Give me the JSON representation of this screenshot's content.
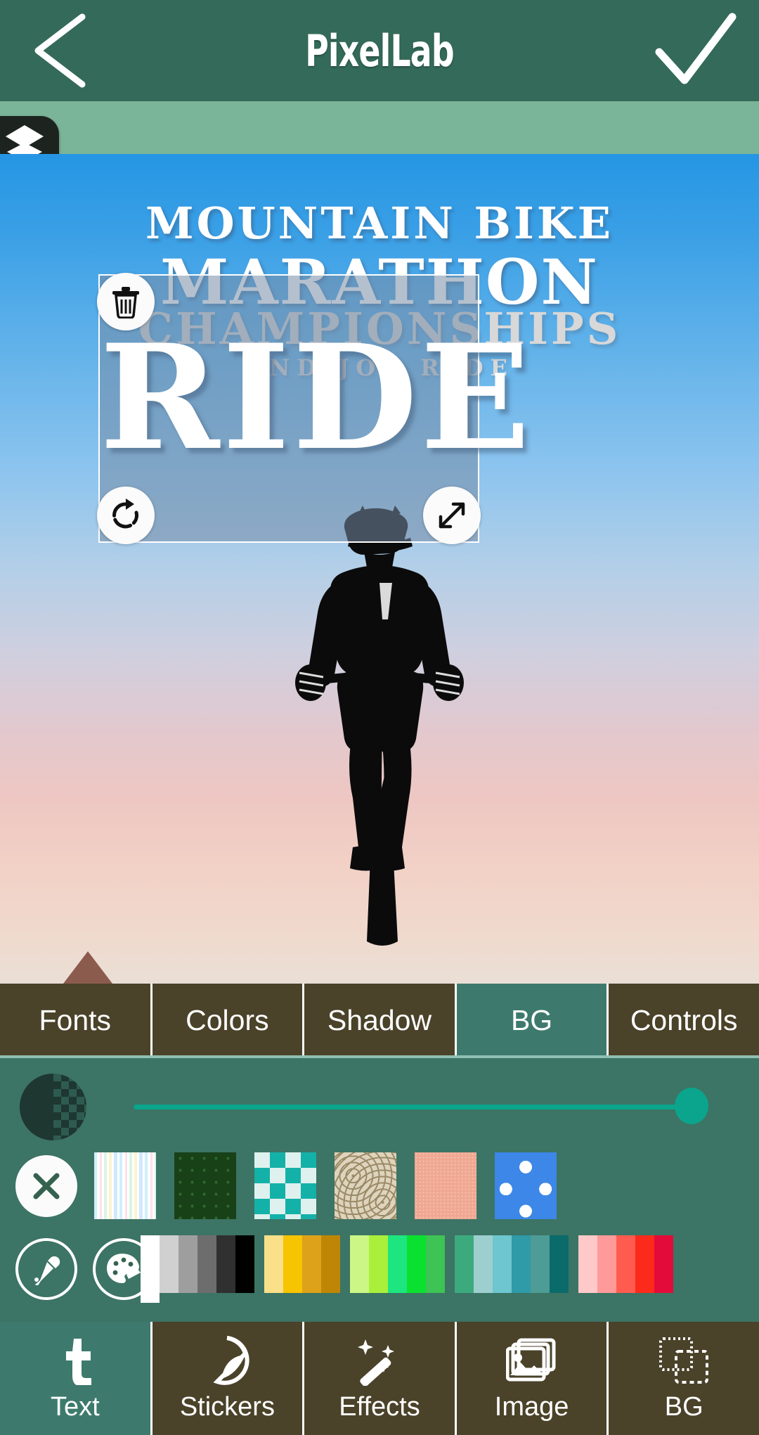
{
  "app": {
    "title": "PixelLab",
    "back_icon": "chevron-left-icon",
    "confirm_icon": "check-icon",
    "layers_icon": "layers-icon"
  },
  "canvas": {
    "poster": {
      "line1": "MOUNTAIN BIKE",
      "line2": "MARATHON",
      "line3": "CHAMPIONSHIPS",
      "line4": "AND JOY RIDE"
    },
    "selection": {
      "selected_text": "RIDE",
      "delete_icon": "trash-icon",
      "rotate_icon": "rotate-icon",
      "resize_icon": "resize-diagonal-icon"
    },
    "artwork_icon": "cyclist-silhouette"
  },
  "tabs": {
    "items": [
      {
        "label": "Fonts",
        "active": false
      },
      {
        "label": "Colors",
        "active": false
      },
      {
        "label": "Shadow",
        "active": false
      },
      {
        "label": "BG",
        "active": true
      },
      {
        "label": "Controls",
        "active": false
      }
    ]
  },
  "bg_panel": {
    "opacity_icon": "opacity-half-checker-icon",
    "opacity_value": 100,
    "clear_icon": "close-x-icon",
    "clear_label": "Clear background",
    "patterns": [
      {
        "name": "pastel-stripes-pattern"
      },
      {
        "name": "dark-green-dots-pattern"
      },
      {
        "name": "teal-argyle-pattern"
      },
      {
        "name": "beige-circles-pattern"
      },
      {
        "name": "pink-texture-pattern"
      },
      {
        "name": "blue-polka-dots-pattern"
      }
    ],
    "eyedropper_icon": "eyedropper-icon",
    "palette_icon": "palette-icon",
    "colors": [
      {
        "hex": "#ffffff",
        "selected": true
      },
      {
        "hex": "#d0d0d0",
        "selected": false
      },
      {
        "hex": "#9e9e9e",
        "selected": false
      },
      {
        "hex": "#6d6d6d",
        "selected": false
      },
      {
        "hex": "#303030",
        "selected": false
      },
      {
        "hex": "#000000",
        "selected": false
      },
      {
        "hex": "#fbe08a",
        "selected": false
      },
      {
        "hex": "#f7c400",
        "selected": false
      },
      {
        "hex": "#dda219",
        "selected": false
      },
      {
        "hex": "#bf8606",
        "selected": false
      },
      {
        "hex": "#ccf787",
        "selected": false
      },
      {
        "hex": "#aaf03b",
        "selected": false
      },
      {
        "hex": "#1de57f",
        "selected": false
      },
      {
        "hex": "#0ae02f",
        "selected": false
      },
      {
        "hex": "#3ec355",
        "selected": false
      },
      {
        "hex": "#3daa7e",
        "selected": false
      },
      {
        "hex": "#9ecfcf",
        "selected": false
      },
      {
        "hex": "#6ec6cf",
        "selected": false
      },
      {
        "hex": "#2f9aa8",
        "selected": false
      },
      {
        "hex": "#4e9c96",
        "selected": false
      },
      {
        "hex": "#0b6a6a",
        "selected": false
      },
      {
        "hex": "#ffc9c9",
        "selected": false
      },
      {
        "hex": "#ff9a9a",
        "selected": false
      },
      {
        "hex": "#ff5b4e",
        "selected": false
      },
      {
        "hex": "#fb2a1a",
        "selected": false
      },
      {
        "hex": "#e30b3a",
        "selected": false
      }
    ]
  },
  "bottom_nav": {
    "items": [
      {
        "label": "Text",
        "icon": "text-t-icon",
        "active": true
      },
      {
        "label": "Stickers",
        "icon": "sticker-icon",
        "active": false
      },
      {
        "label": "Effects",
        "icon": "magic-wand-icon",
        "active": false
      },
      {
        "label": "Image",
        "icon": "image-stack-icon",
        "active": false
      },
      {
        "label": "BG",
        "icon": "background-layers-icon",
        "active": false
      }
    ]
  },
  "colors": {
    "topbar": "#346a59",
    "layerbar": "#7bb599",
    "tabbar": "#4a4229",
    "tab_active": "#3d7a6d",
    "panel": "#3c7465",
    "slider_accent": "#0aa58c"
  }
}
